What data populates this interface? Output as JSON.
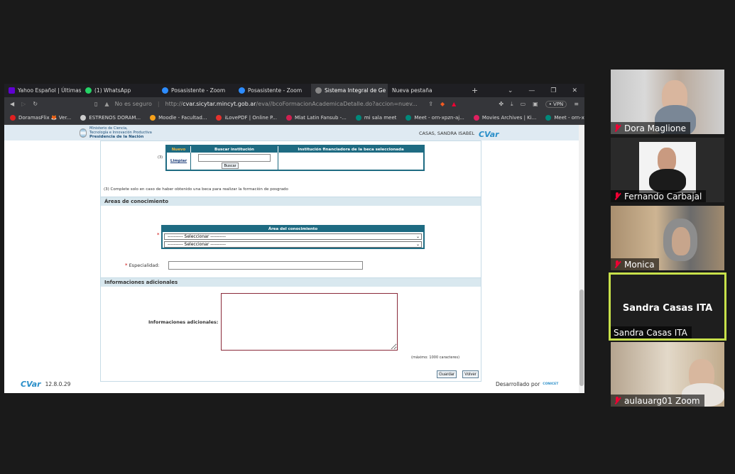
{
  "browser": {
    "tabs": [
      {
        "label": "Yahoo Español | Últimas no",
        "icon_color": "#6001d2"
      },
      {
        "label": "(1) WhatsApp",
        "icon_color": "#25d366"
      },
      {
        "label": "Posasistente - Zoom",
        "icon_color": "#2d8cff"
      },
      {
        "label": "Posasistente - Zoom",
        "icon_color": "#2d8cff"
      },
      {
        "label": "Sistema Integral de Ge",
        "icon_color": "#888888",
        "active": true
      },
      {
        "label": "Nueva pestaña",
        "icon_color": "#555555"
      }
    ],
    "new_tab": "+",
    "window_controls": [
      "⌄",
      "—",
      "❐",
      "✕"
    ],
    "address": {
      "security": "No es seguro",
      "url_prefix": "http://",
      "url_domain": "cvar.sicytar.mincyt.gob.ar",
      "url_rest": "/eva//bcoFormacionAcademicaDetalle.do?accion=nuev..."
    },
    "vpn": "• VPN",
    "bookmarks": [
      {
        "label": "DoramasFlix 🦊 Ver...",
        "color": "#e02020"
      },
      {
        "label": "ESTRENOS DORAM...",
        "color": "#cccccc"
      },
      {
        "label": "Moodle - Facultad...",
        "color": "#f7a11a"
      },
      {
        "label": "iLovePDF | Online P...",
        "color": "#e5322d"
      },
      {
        "label": "Mlat Latin Fansub -...",
        "color": "#d02050"
      },
      {
        "label": "mi sala meet",
        "color": "#00897b"
      },
      {
        "label": "Meet - orn-xpzn-aj...",
        "color": "#00897b"
      },
      {
        "label": "Movies Archives | Ki...",
        "color": "#e02060"
      },
      {
        "label": "Meet - orn-xpzn-aj...",
        "color": "#00897b"
      }
    ]
  },
  "page": {
    "gov_lines": [
      "Ministerio de Ciencia,",
      "Tecnología e Innovación Productiva"
    ],
    "gov_presidencia": "Presidencia de la Nación",
    "user": "CASAS, SANDRA ISABEL",
    "logo": "CV",
    "logo_suffix": "ar",
    "beca": {
      "col_nuevo": "Nuevo",
      "col_buscar": "Buscar institución",
      "col_institucion": "Institución financiadora de la beca seleccionada",
      "limpiar": "Limpiar",
      "buscar_button": "Buscar",
      "note_marker": "(3)"
    },
    "footnote": "(3) Complete solo en caso de haber obtenido una beca para realizar la formación de posgrado",
    "areas_title": "Áreas de conocimiento",
    "area_table_header": "Área del conocimiento",
    "select_1": "---------- Seleccionar ----------",
    "select_2": "---------- Seleccionar ----------",
    "required_mark": "*",
    "especialidad_label": "Especialidad:",
    "info_title": "Informaciones adicionales",
    "info_label": "Informaciones adicionales:",
    "max_chars": "(máximo: 1000 caracteres)",
    "guardar": "Guardar",
    "volver": "Volver",
    "version_logo": "CVar",
    "version": "12.8.0.29",
    "developed_by": "Desarrollado por",
    "conicet": "CONICET"
  },
  "participants": [
    {
      "name": "Dora Maglione",
      "muted": true
    },
    {
      "name": "Fernando Carbajal",
      "muted": true
    },
    {
      "name": "Monica",
      "muted": true
    },
    {
      "name": "Sandra Casas ITA",
      "muted": false,
      "speaking": true
    },
    {
      "name": "aulauarg01 Zoom",
      "muted": true
    }
  ],
  "colors": {
    "table_header": "#1e6b82",
    "section_bar": "#d9e8ef",
    "speaker_border": "#c7e04a"
  }
}
